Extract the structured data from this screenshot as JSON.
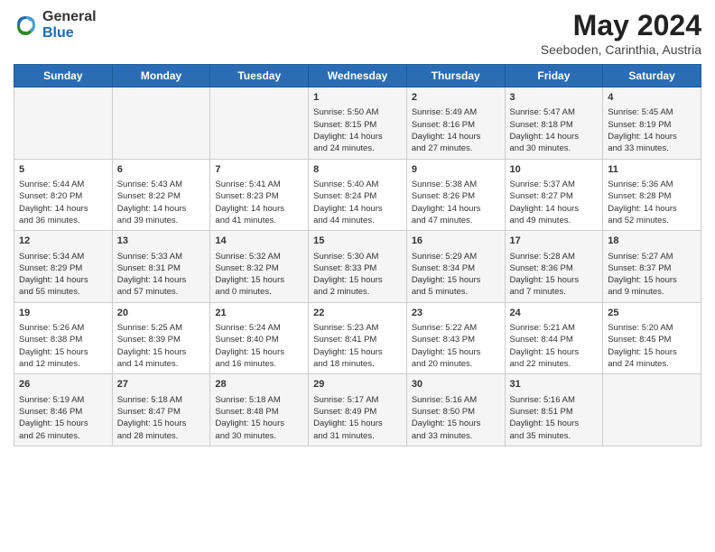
{
  "logo": {
    "general": "General",
    "blue": "Blue"
  },
  "title": "May 2024",
  "subtitle": "Seeboden, Carinthia, Austria",
  "days_of_week": [
    "Sunday",
    "Monday",
    "Tuesday",
    "Wednesday",
    "Thursday",
    "Friday",
    "Saturday"
  ],
  "weeks": [
    [
      {
        "day": "",
        "content": ""
      },
      {
        "day": "",
        "content": ""
      },
      {
        "day": "",
        "content": ""
      },
      {
        "day": "1",
        "content": "Sunrise: 5:50 AM\nSunset: 8:15 PM\nDaylight: 14 hours\nand 24 minutes."
      },
      {
        "day": "2",
        "content": "Sunrise: 5:49 AM\nSunset: 8:16 PM\nDaylight: 14 hours\nand 27 minutes."
      },
      {
        "day": "3",
        "content": "Sunrise: 5:47 AM\nSunset: 8:18 PM\nDaylight: 14 hours\nand 30 minutes."
      },
      {
        "day": "4",
        "content": "Sunrise: 5:45 AM\nSunset: 8:19 PM\nDaylight: 14 hours\nand 33 minutes."
      }
    ],
    [
      {
        "day": "5",
        "content": "Sunrise: 5:44 AM\nSunset: 8:20 PM\nDaylight: 14 hours\nand 36 minutes."
      },
      {
        "day": "6",
        "content": "Sunrise: 5:43 AM\nSunset: 8:22 PM\nDaylight: 14 hours\nand 39 minutes."
      },
      {
        "day": "7",
        "content": "Sunrise: 5:41 AM\nSunset: 8:23 PM\nDaylight: 14 hours\nand 41 minutes."
      },
      {
        "day": "8",
        "content": "Sunrise: 5:40 AM\nSunset: 8:24 PM\nDaylight: 14 hours\nand 44 minutes."
      },
      {
        "day": "9",
        "content": "Sunrise: 5:38 AM\nSunset: 8:26 PM\nDaylight: 14 hours\nand 47 minutes."
      },
      {
        "day": "10",
        "content": "Sunrise: 5:37 AM\nSunset: 8:27 PM\nDaylight: 14 hours\nand 49 minutes."
      },
      {
        "day": "11",
        "content": "Sunrise: 5:36 AM\nSunset: 8:28 PM\nDaylight: 14 hours\nand 52 minutes."
      }
    ],
    [
      {
        "day": "12",
        "content": "Sunrise: 5:34 AM\nSunset: 8:29 PM\nDaylight: 14 hours\nand 55 minutes."
      },
      {
        "day": "13",
        "content": "Sunrise: 5:33 AM\nSunset: 8:31 PM\nDaylight: 14 hours\nand 57 minutes."
      },
      {
        "day": "14",
        "content": "Sunrise: 5:32 AM\nSunset: 8:32 PM\nDaylight: 15 hours\nand 0 minutes."
      },
      {
        "day": "15",
        "content": "Sunrise: 5:30 AM\nSunset: 8:33 PM\nDaylight: 15 hours\nand 2 minutes."
      },
      {
        "day": "16",
        "content": "Sunrise: 5:29 AM\nSunset: 8:34 PM\nDaylight: 15 hours\nand 5 minutes."
      },
      {
        "day": "17",
        "content": "Sunrise: 5:28 AM\nSunset: 8:36 PM\nDaylight: 15 hours\nand 7 minutes."
      },
      {
        "day": "18",
        "content": "Sunrise: 5:27 AM\nSunset: 8:37 PM\nDaylight: 15 hours\nand 9 minutes."
      }
    ],
    [
      {
        "day": "19",
        "content": "Sunrise: 5:26 AM\nSunset: 8:38 PM\nDaylight: 15 hours\nand 12 minutes."
      },
      {
        "day": "20",
        "content": "Sunrise: 5:25 AM\nSunset: 8:39 PM\nDaylight: 15 hours\nand 14 minutes."
      },
      {
        "day": "21",
        "content": "Sunrise: 5:24 AM\nSunset: 8:40 PM\nDaylight: 15 hours\nand 16 minutes."
      },
      {
        "day": "22",
        "content": "Sunrise: 5:23 AM\nSunset: 8:41 PM\nDaylight: 15 hours\nand 18 minutes."
      },
      {
        "day": "23",
        "content": "Sunrise: 5:22 AM\nSunset: 8:43 PM\nDaylight: 15 hours\nand 20 minutes."
      },
      {
        "day": "24",
        "content": "Sunrise: 5:21 AM\nSunset: 8:44 PM\nDaylight: 15 hours\nand 22 minutes."
      },
      {
        "day": "25",
        "content": "Sunrise: 5:20 AM\nSunset: 8:45 PM\nDaylight: 15 hours\nand 24 minutes."
      }
    ],
    [
      {
        "day": "26",
        "content": "Sunrise: 5:19 AM\nSunset: 8:46 PM\nDaylight: 15 hours\nand 26 minutes."
      },
      {
        "day": "27",
        "content": "Sunrise: 5:18 AM\nSunset: 8:47 PM\nDaylight: 15 hours\nand 28 minutes."
      },
      {
        "day": "28",
        "content": "Sunrise: 5:18 AM\nSunset: 8:48 PM\nDaylight: 15 hours\nand 30 minutes."
      },
      {
        "day": "29",
        "content": "Sunrise: 5:17 AM\nSunset: 8:49 PM\nDaylight: 15 hours\nand 31 minutes."
      },
      {
        "day": "30",
        "content": "Sunrise: 5:16 AM\nSunset: 8:50 PM\nDaylight: 15 hours\nand 33 minutes."
      },
      {
        "day": "31",
        "content": "Sunrise: 5:16 AM\nSunset: 8:51 PM\nDaylight: 15 hours\nand 35 minutes."
      },
      {
        "day": "",
        "content": ""
      }
    ]
  ]
}
